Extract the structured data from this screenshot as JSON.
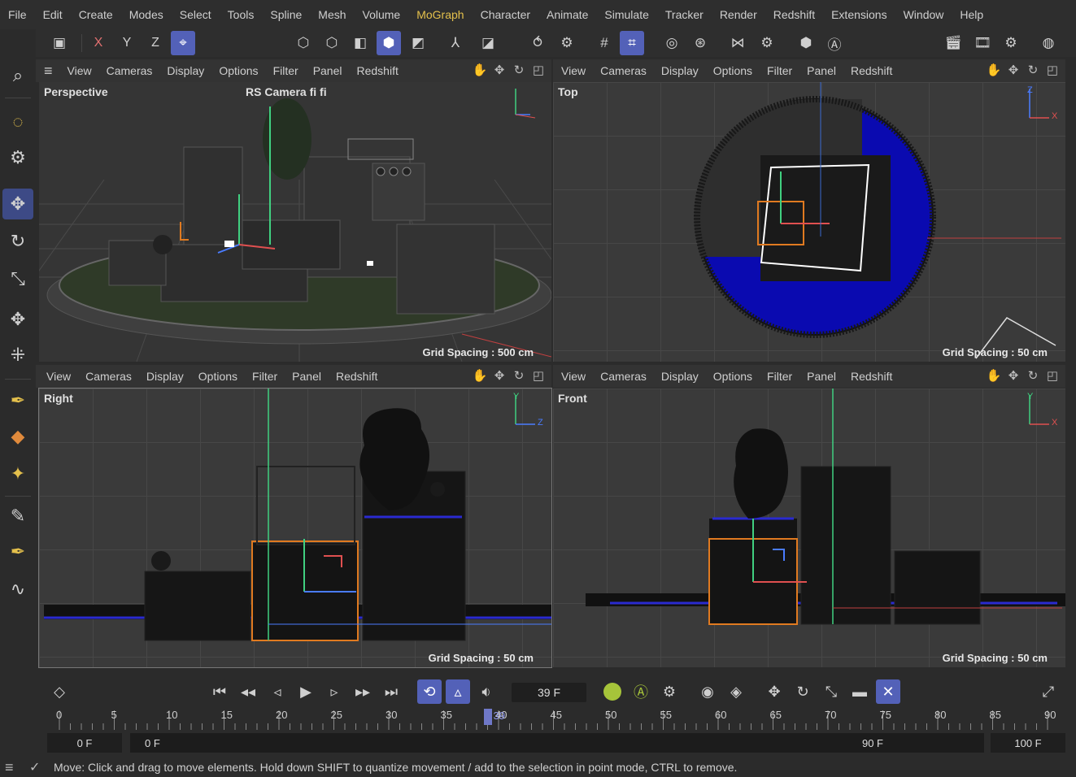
{
  "menubar": {
    "items": [
      "File",
      "Edit",
      "Create",
      "Modes",
      "Select",
      "Tools",
      "Spline",
      "Mesh",
      "Volume",
      "MoGraph",
      "Character",
      "Animate",
      "Simulate",
      "Tracker",
      "Render",
      "Redshift",
      "Extensions",
      "Window",
      "Help"
    ],
    "active_index": 9
  },
  "toolbar": {
    "axis_x": "X",
    "axis_y": "Y",
    "axis_z": "Z"
  },
  "viewport_menu": [
    "View",
    "Cameras",
    "Display",
    "Options",
    "Filter",
    "Panel",
    "Redshift"
  ],
  "viewports": {
    "perspective": {
      "label": "Perspective",
      "camera": "RS Camera fi fi",
      "grid_spacing": "Grid Spacing : 500 cm"
    },
    "top": {
      "label": "Top",
      "grid_spacing": "Grid Spacing : 50 cm"
    },
    "right": {
      "label": "Right",
      "grid_spacing": "Grid Spacing : 50 cm"
    },
    "front": {
      "label": "Front",
      "grid_spacing": "Grid Spacing : 50 cm"
    }
  },
  "axis_labels": {
    "x": "X",
    "y": "Y",
    "z": "Z"
  },
  "timeline": {
    "current_frame": "39 F",
    "ruler_ticks": [
      "0",
      "5",
      "10",
      "15",
      "20",
      "25",
      "30",
      "35",
      "40",
      "45",
      "50",
      "55",
      "60",
      "65",
      "70",
      "75",
      "80",
      "85",
      "90"
    ],
    "playhead_value": 39,
    "playhead_label": "39",
    "start_field": "0 F",
    "range_start": "0 F",
    "range_end": "90 F",
    "end_field": "100 F"
  },
  "status": {
    "message": "Move: Click and drag to move elements. Hold down SHIFT to quantize movement / add to the selection in point mode, CTRL to remove."
  },
  "colors": {
    "accent": "#5361b8",
    "menu_active": "#e4c04c",
    "axis_x": "#e05050",
    "axis_y": "#40d080",
    "axis_z": "#4a7cff",
    "selection_orange": "#e07a20",
    "top_blue": "#0a0ab0"
  }
}
